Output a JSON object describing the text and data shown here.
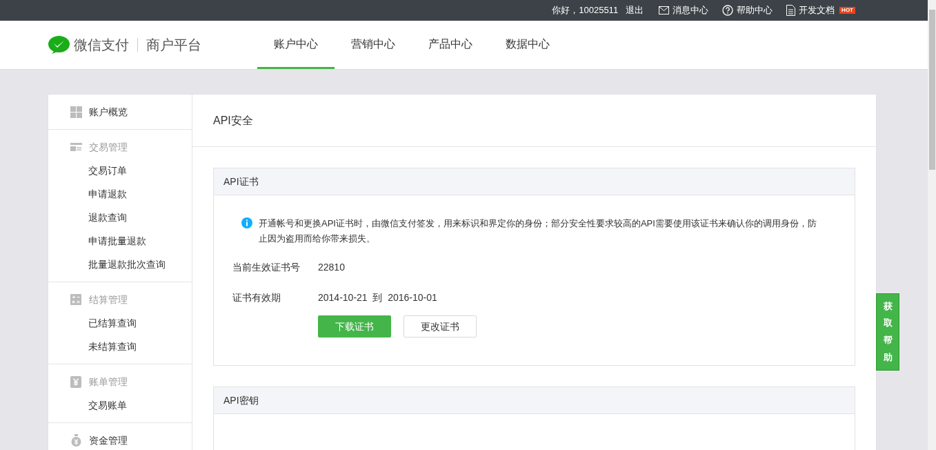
{
  "top_bar": {
    "greeting": "你好，10025511",
    "logout": "退出",
    "links": [
      {
        "kind": "mail",
        "label": "消息中心"
      },
      {
        "kind": "help",
        "label": "帮助中心"
      },
      {
        "kind": "doc",
        "label": "开发文档",
        "badge": "HOT"
      }
    ]
  },
  "header": {
    "brand": "微信支付",
    "platform": "商户平台",
    "tabs": [
      {
        "label": "账户中心",
        "selected": true
      },
      {
        "label": "营销中心",
        "selected": false
      },
      {
        "label": "产品中心",
        "selected": false
      },
      {
        "label": "数据中心",
        "selected": false
      }
    ]
  },
  "sidebar": {
    "sections": [
      {
        "kind": "grid",
        "label": "账户概览"
      },
      {
        "kind": "trade",
        "label": "交易管理",
        "children": [
          "交易订单",
          "申请退款",
          "退款查询",
          "申请批量退款",
          "批量退款批次查询"
        ]
      },
      {
        "kind": "calc",
        "label": "结算管理",
        "children": [
          "已结算查询",
          "未结算查询"
        ]
      },
      {
        "kind": "yen",
        "label": "账单管理",
        "children": [
          "交易账单"
        ]
      },
      {
        "kind": "bag",
        "label": "资金管理"
      }
    ]
  },
  "page_title": "API安全",
  "cert_panel": {
    "title": "API证书",
    "notice": "开通帐号和更换API证书时，由微信支付签发，用来标识和界定你的身份；部分安全性要求较高的API需要使用该证书来确认你的调用身份，防止因为盗用而给你带来损失。",
    "fields": [
      {
        "label": "当前生效证书号",
        "value": "22810"
      },
      {
        "label": "证书有效期",
        "value": "2014-10-21  到  2016-10-01"
      }
    ],
    "buttons": [
      {
        "kind": "primary",
        "label": "下载证书"
      },
      {
        "kind": "default",
        "label": "更改证书"
      }
    ]
  },
  "key_panel": {
    "title": "API密钥"
  },
  "help_tab": "获取帮助"
}
